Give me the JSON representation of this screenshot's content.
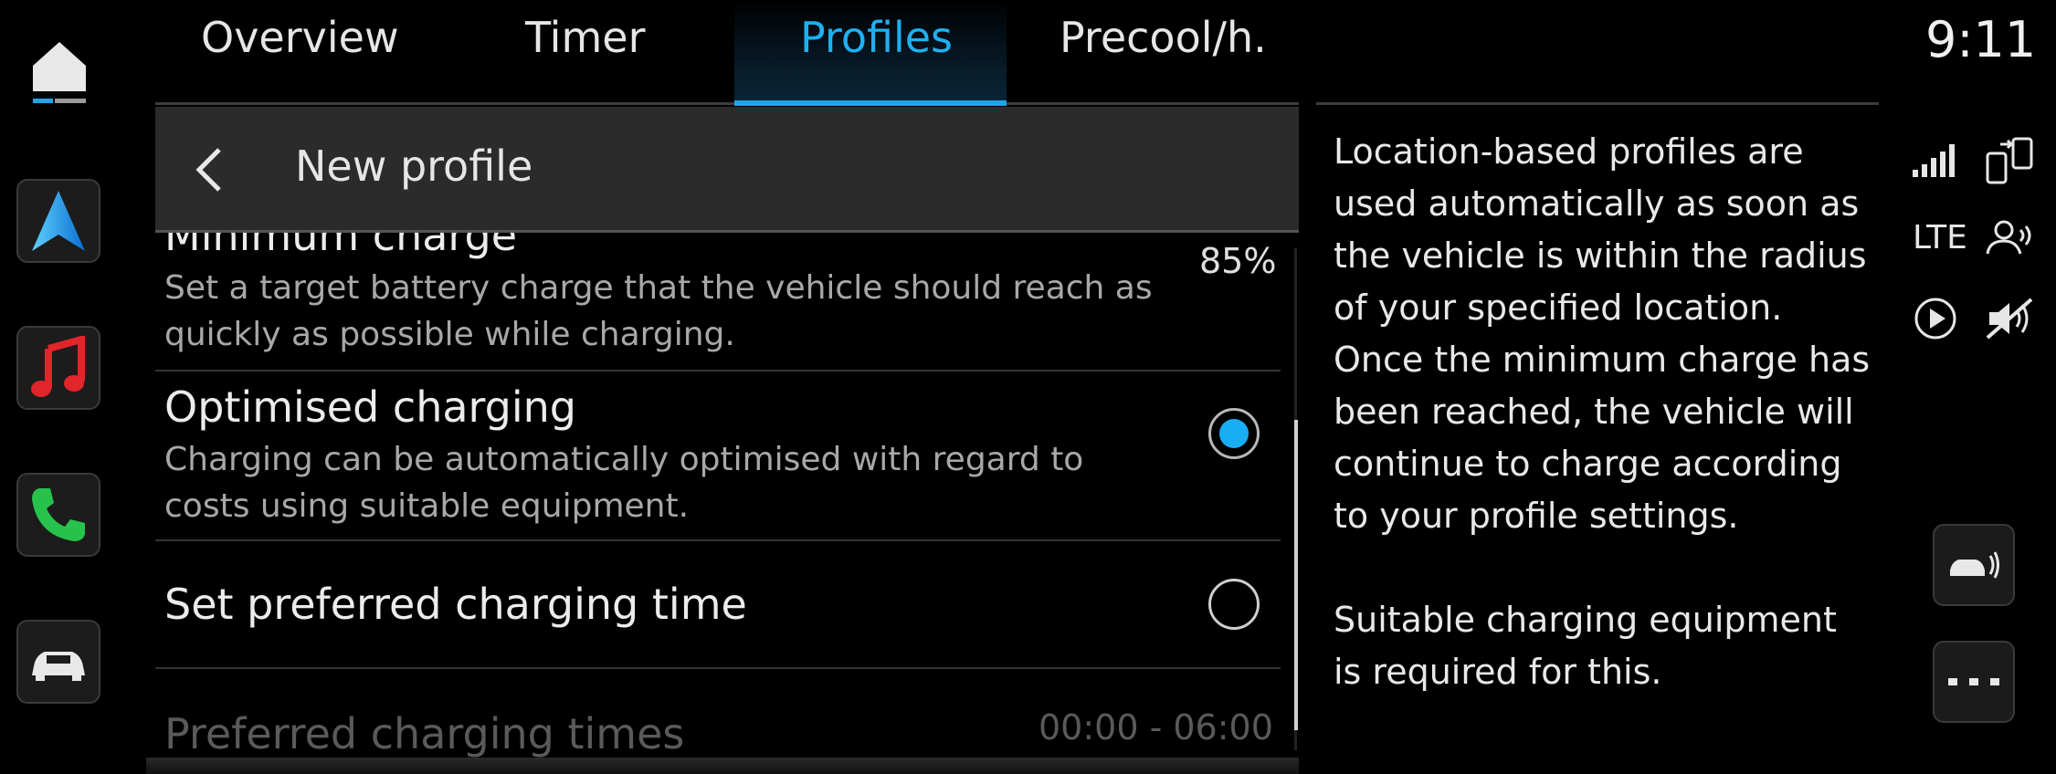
{
  "tabs": [
    {
      "label": "Overview"
    },
    {
      "label": "Timer"
    },
    {
      "label": "Profiles"
    },
    {
      "label": "Precool/h."
    }
  ],
  "active_tab": "Profiles",
  "clock": "9:11",
  "header": {
    "title": "New profile"
  },
  "settings": {
    "minimum_charge": {
      "title": "Minimum charge",
      "description": "Set a target battery charge that the vehicle should reach as quickly as possible while charging.",
      "value": "85%"
    },
    "optimised_charging": {
      "title": "Optimised charging",
      "description": "Charging can be automatically optimised with regard to costs using suitable equipment.",
      "selected": true
    },
    "preferred_time": {
      "title": "Set preferred charging time",
      "selected": false
    },
    "preferred_times": {
      "title": "Preferred charging times",
      "value": "00:00 - 06:00"
    }
  },
  "info": {
    "paragraph1": "Location-based profiles are used automatically as soon as the vehicle is within the radius of your specified location. Once the minimum charge has been reached, the vehicle will continue to charge according to your profile settings.",
    "paragraph2": "Suitable charging equipment is required for this."
  },
  "status": {
    "network": "LTE"
  },
  "dock": [
    "home-icon",
    "navigation-icon",
    "music-icon",
    "phone-icon",
    "car-icon"
  ],
  "colors": {
    "accent": "#1fb0f2",
    "background": "#000000",
    "header": "#2b2b2b"
  }
}
